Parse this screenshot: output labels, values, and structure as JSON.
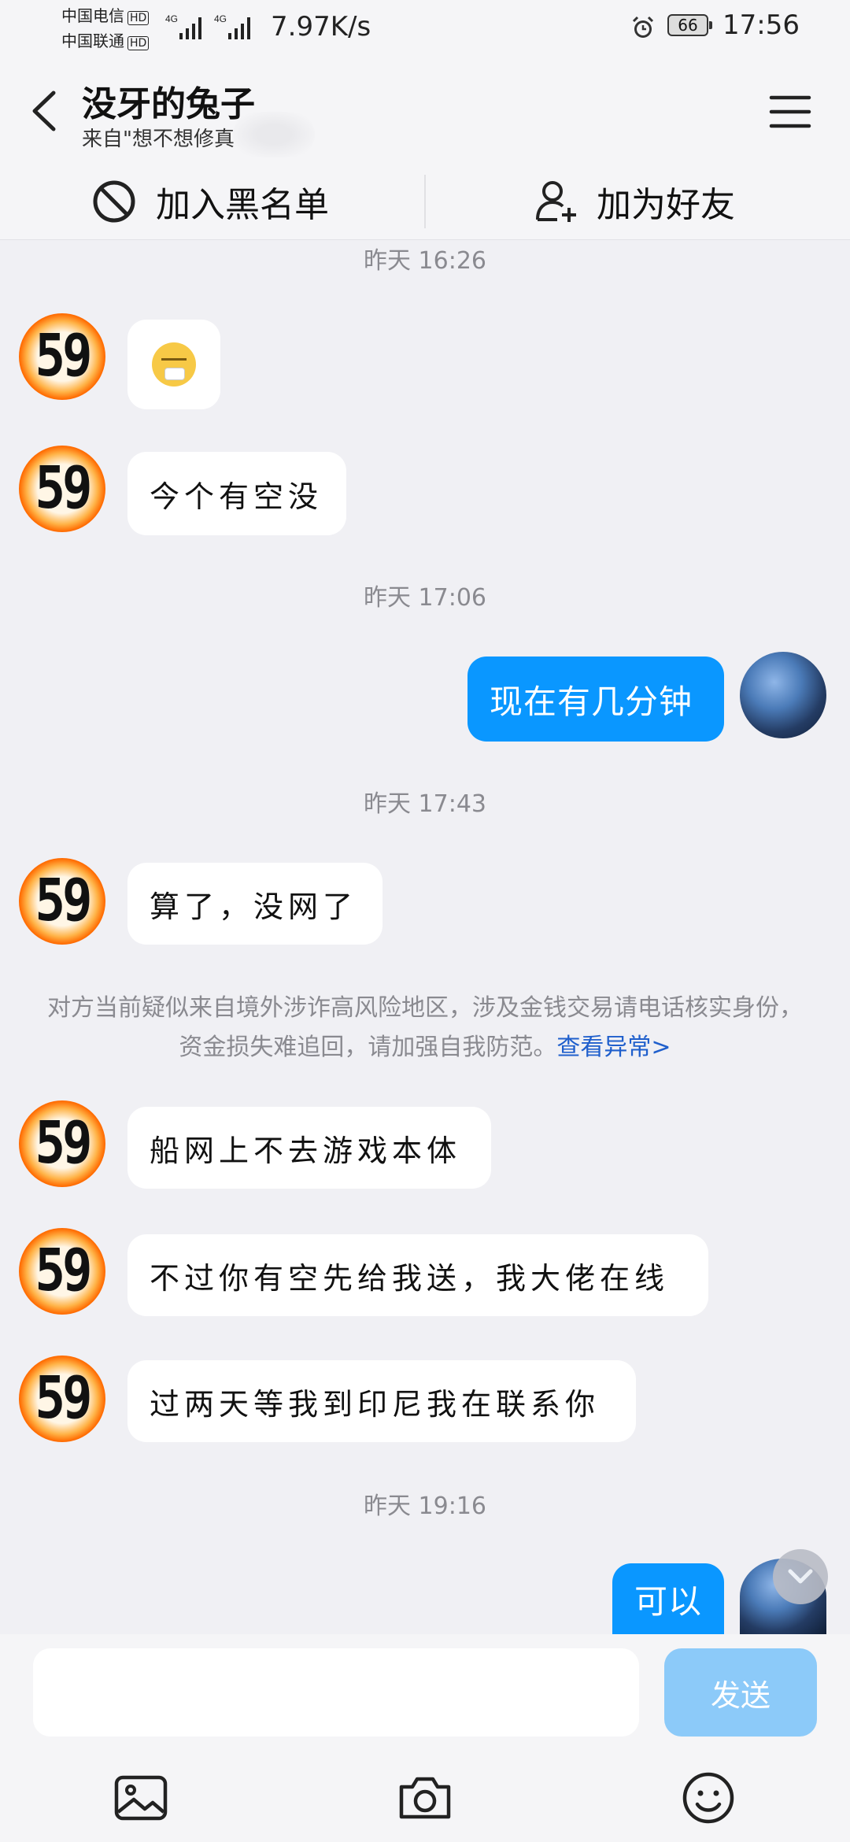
{
  "status_bar": {
    "carrier1": "中国电信",
    "carrier2": "中国联通",
    "hd": "HD",
    "net_label": "4G",
    "net_speed": "7.97K/s",
    "battery": "66",
    "time": "17:56"
  },
  "header": {
    "title": "没牙的兔子",
    "subtitle": "来自\"想不想修真      区\"群"
  },
  "actions": {
    "block_label": "加入黑名单",
    "add_friend_label": "加为好友"
  },
  "timestamps": {
    "t1": "昨天 16:26",
    "t2": "昨天 17:06",
    "t3": "昨天 17:43",
    "t4": "昨天 19:16"
  },
  "avatar_text": "59",
  "messages": {
    "m2": "今个有空没",
    "m3": "现在有几分钟",
    "m4": "算了，没网了",
    "m5": "船网上不去游戏本体",
    "m6": "不过你有空先给我送，我大佬在线",
    "m7": "过两天等我到印尼我在联系你",
    "m8": "可以"
  },
  "warning": {
    "text": "对方当前疑似来自境外涉诈高风险地区，涉及金钱交易请电话核实身份，资金损失难追回，请加强自我防范。",
    "link": "查看异常>"
  },
  "input": {
    "placeholder": "",
    "send_label": "发送"
  },
  "icons": {
    "back": "back-arrow-icon",
    "menu": "hamburger-menu-icon",
    "block": "prohibit-icon",
    "add_friend": "add-person-icon",
    "image": "image-icon",
    "camera": "camera-icon",
    "emoji": "emoji-icon",
    "scroll_down": "chevron-down-icon"
  },
  "colors": {
    "outgoing_bubble": "#0a97ff",
    "send_button": "#8ccaf9",
    "link": "#1f5fcc"
  }
}
